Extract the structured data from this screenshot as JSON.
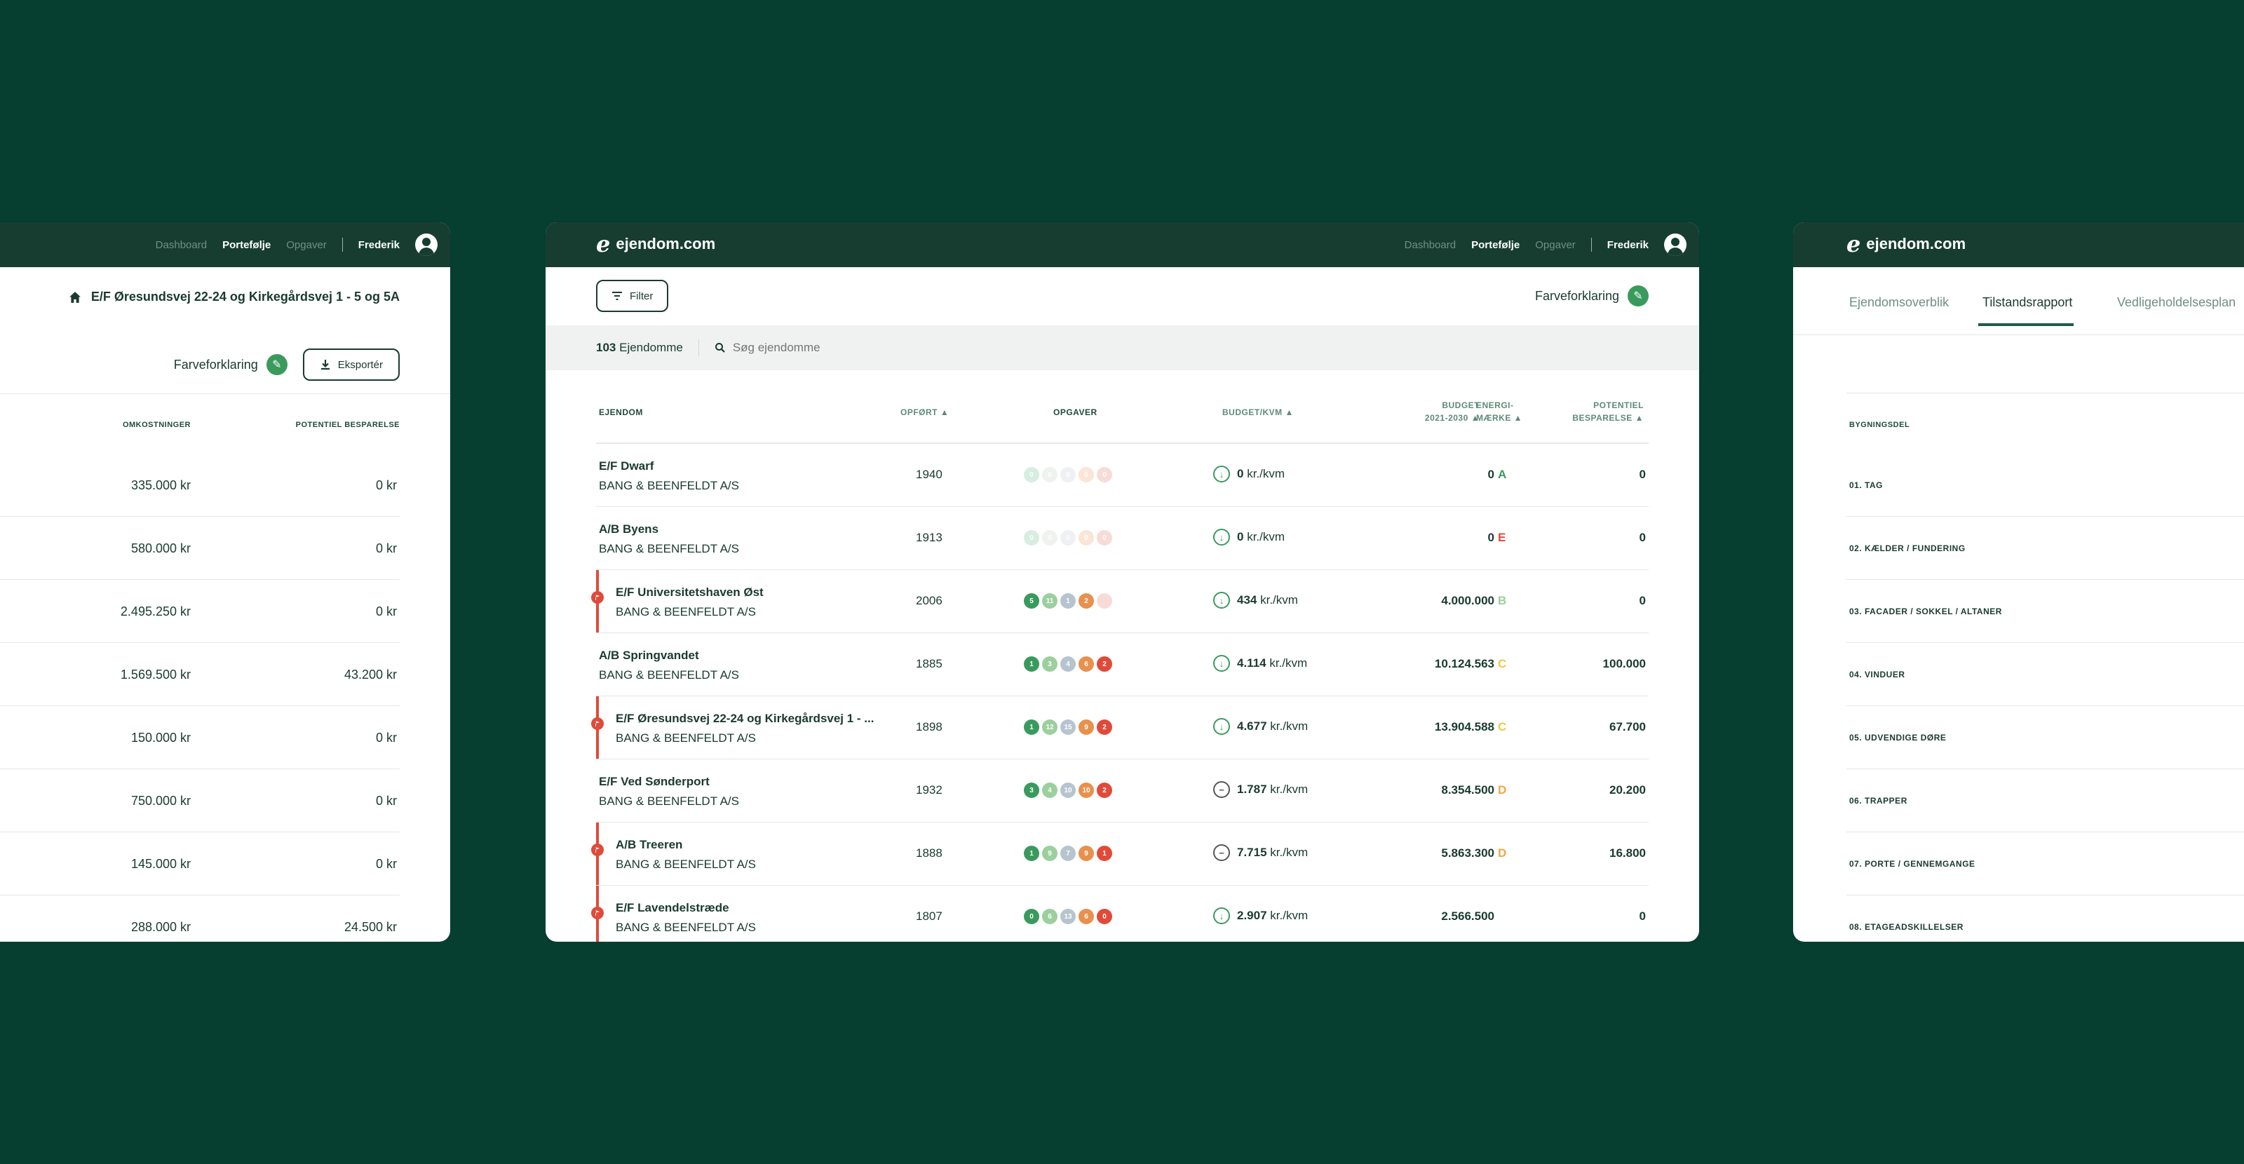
{
  "brand": {
    "logo_mark": "e",
    "name": "ejendom.com"
  },
  "nav": {
    "dashboard": "Dashboard",
    "portfolio": "Portefølje",
    "tasks": "Opgaver",
    "user": "Frederik"
  },
  "colors": {
    "background": "#063e2f",
    "topbar": "#173d31",
    "accent_green": "#3a9a5e",
    "alert_red": "#e04a3a",
    "orange": "#e8904e"
  },
  "left": {
    "title": "E/F Øresundsvej 22-24 og Kirkegårdsvej 1 - 5 og 5A",
    "legend": "Farveforklaring",
    "export": "Eksportér",
    "col_costs": "OMKOSTNINGER",
    "col_savings": "POTENTIEL BESPARELSE",
    "rows": [
      {
        "cost": "335.000 kr",
        "saving": "0 kr"
      },
      {
        "cost": "580.000 kr",
        "saving": "0 kr"
      },
      {
        "cost": "2.495.250 kr",
        "saving": "0 kr"
      },
      {
        "cost": "1.569.500 kr",
        "saving": "43.200 kr"
      },
      {
        "cost": "150.000 kr",
        "saving": "0 kr"
      },
      {
        "cost": "750.000 kr",
        "saving": "0 kr"
      },
      {
        "cost": "145.000 kr",
        "saving": "0 kr"
      },
      {
        "cost": "288.000 kr",
        "saving": "24.500 kr"
      }
    ]
  },
  "center": {
    "filter": "Filter",
    "legend": "Farveforklaring",
    "count": "103",
    "count_label": "Ejendomme",
    "search_placeholder": "Søg ejendomme",
    "headers": {
      "property": "EJENDOM",
      "built": "OPFØRT",
      "tasks": "OPGAVER",
      "budget_kvm": "BUDGET/KVM",
      "budget_l1": "BUDGET",
      "budget_l2": "2021-2030",
      "energy_l1": "ENERGI-",
      "energy_l2": "MÆRKE",
      "savings_l1": "POTENTIEL",
      "savings_l2": "BESPARELSE"
    },
    "kvm_unit": "kr./kvm",
    "rows": [
      {
        "name": "E/F Dwarf",
        "owner": "BANG & BEENFELDT A/S",
        "year": "1940",
        "flag": false,
        "tasks": [
          "0",
          "0",
          "0",
          "0",
          "0"
        ],
        "faded": true,
        "trend": "down",
        "kvm": "0",
        "budget": "0",
        "energy": "A",
        "energy_color": "#3a9a5e",
        "savings": "0"
      },
      {
        "name": "A/B Byens",
        "owner": "BANG & BEENFELDT A/S",
        "year": "1913",
        "flag": false,
        "tasks": [
          "0",
          "0",
          "0",
          "0",
          "0"
        ],
        "faded": true,
        "trend": "down",
        "kvm": "0",
        "budget": "0",
        "energy": "E",
        "energy_color": "#e04a3a",
        "savings": "0"
      },
      {
        "name": "E/F Universitetshaven Øst",
        "owner": "BANG & BEENFELDT A/S",
        "year": "2006",
        "flag": true,
        "tasks": [
          "5",
          "11",
          "1",
          "2",
          ""
        ],
        "faded": false,
        "trend": "down",
        "kvm": "434",
        "budget": "4.000.000",
        "energy": "B",
        "energy_color": "#9ccf9e",
        "savings": "0"
      },
      {
        "name": "A/B Springvandet",
        "owner": "BANG & BEENFELDT A/S",
        "year": "1885",
        "flag": false,
        "tasks": [
          "1",
          "3",
          "4",
          "6",
          "2"
        ],
        "faded": false,
        "trend": "down",
        "kvm": "4.114",
        "budget": "10.124.563",
        "energy": "C",
        "energy_color": "#f0c84a",
        "savings": "100.000"
      },
      {
        "name": "E/F Øresundsvej 22-24 og Kirkegårdsvej 1 - ...",
        "owner": "BANG & BEENFELDT A/S",
        "year": "1898",
        "flag": true,
        "tasks": [
          "1",
          "12",
          "15",
          "9",
          "2"
        ],
        "faded": false,
        "trend": "down",
        "kvm": "4.677",
        "budget": "13.904.588",
        "energy": "C",
        "energy_color": "#f0c84a",
        "savings": "67.700"
      },
      {
        "name": "E/F Ved Sønderport",
        "owner": "BANG & BEENFELDT A/S",
        "year": "1932",
        "flag": false,
        "tasks": [
          "3",
          "4",
          "10",
          "10",
          "2"
        ],
        "faded": false,
        "trend": "flat",
        "kvm": "1.787",
        "budget": "8.354.500",
        "energy": "D",
        "energy_color": "#f0a845",
        "savings": "20.200"
      },
      {
        "name": "A/B Treeren",
        "owner": "BANG & BEENFELDT A/S",
        "year": "1888",
        "flag": true,
        "tasks": [
          "1",
          "9",
          "7",
          "9",
          "1"
        ],
        "faded": false,
        "trend": "flat",
        "kvm": "7.715",
        "budget": "5.863.300",
        "energy": "D",
        "energy_color": "#f0a845",
        "savings": "16.800"
      },
      {
        "name": "E/F Lavendelstræde",
        "owner": "BANG & BEENFELDT A/S",
        "year": "1807",
        "flag": true,
        "tasks": [
          "0",
          "6",
          "13",
          "6",
          "0"
        ],
        "faded": false,
        "trend": "down",
        "kvm": "2.907",
        "budget": "2.566.500",
        "energy": "",
        "energy_color": "#ffffff",
        "savings": "0"
      }
    ]
  },
  "right": {
    "tabs": [
      "Ejendomsoverblik",
      "Tilstandsrapport",
      "Vedligeholdelsesplan"
    ],
    "col_part": "BYGNINGSDEL",
    "items": [
      "01. TAG",
      "02. KÆLDER / FUNDERING",
      "03. FACADER / SOKKEL / ALTANER",
      "04. VINDUER",
      "05. UDVENDIGE DØRE",
      "06. TRAPPER",
      "07. PORTE / GENNEMGANGE",
      "08. ETAGEADSKILLELSER"
    ]
  }
}
